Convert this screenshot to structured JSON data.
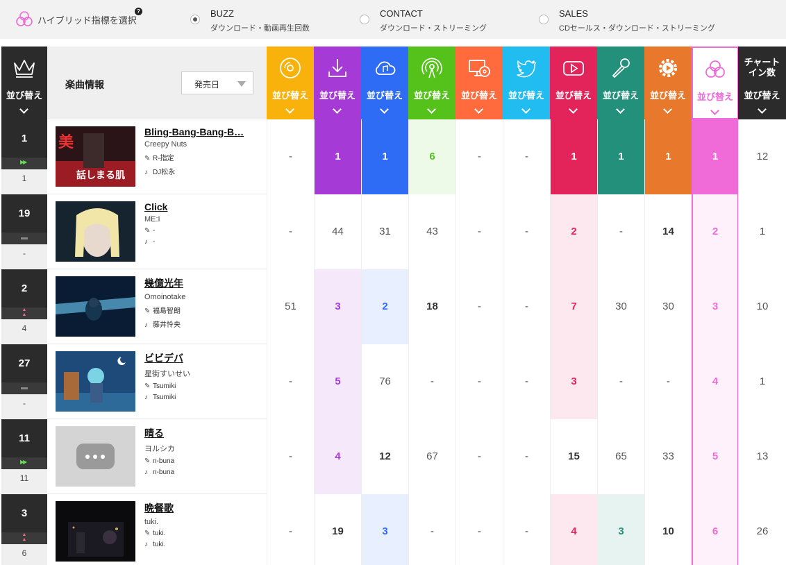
{
  "selector": {
    "title": "ハイブリッド指標を選択",
    "help": "?",
    "options": [
      {
        "name": "BUZZ",
        "sub": "ダウンロード・動画再生回数",
        "selected": true
      },
      {
        "name": "CONTACT",
        "sub": "ダウンロード・ストリーミング",
        "selected": false
      },
      {
        "name": "SALES",
        "sub": "CDセールス・ダウンロード・ストリーミング",
        "selected": false
      }
    ]
  },
  "header": {
    "sort_label": "並び替え",
    "info_title": "楽曲情報",
    "date_select": "発売日",
    "chart_in_title_1": "チャート",
    "chart_in_title_2": "イン数"
  },
  "columns": [
    {
      "icon": "cd-icon",
      "color": "#f9b20c"
    },
    {
      "icon": "download-icon",
      "color": "#a53ad6"
    },
    {
      "icon": "cloud-music-icon",
      "color": "#2f6cf5"
    },
    {
      "icon": "broadcast-icon",
      "color": "#55c21c"
    },
    {
      "icon": "pc-cd-icon",
      "color": "#ff6b3c"
    },
    {
      "icon": "twitter-icon",
      "color": "#21bdf0"
    },
    {
      "icon": "youtube-icon",
      "color": "#e3245a"
    },
    {
      "icon": "karaoke-mic-icon",
      "color": "#23907c"
    },
    {
      "icon": "gear-play-icon",
      "color": "#e8782c"
    },
    {
      "icon": "hybrid-icon",
      "color": "#f06ad8"
    }
  ],
  "rows": [
    {
      "rank": "1",
      "prev": "1",
      "move": "up",
      "title": "Bling-Bang-Bang-B…",
      "artist": "Creepy Nuts",
      "lyricist": "R-指定",
      "composer": "DJ松永",
      "values": [
        "-",
        "1",
        "1",
        "6",
        "-",
        "-",
        "1",
        "1",
        "1",
        "1"
      ],
      "chart_in": "12"
    },
    {
      "rank": "19",
      "prev": "-",
      "move": "same",
      "title": "Click",
      "artist": "ME:I",
      "lyricist": "-",
      "composer": "-",
      "values": [
        "-",
        "44",
        "31",
        "43",
        "-",
        "-",
        "2",
        "-",
        "14",
        "2"
      ],
      "chart_in": "1"
    },
    {
      "rank": "2",
      "prev": "4",
      "move": "rise",
      "title": "幾億光年",
      "artist": "Omoinotake",
      "lyricist": "福島智朗",
      "composer": "藤井怜央",
      "values": [
        "51",
        "3",
        "2",
        "18",
        "-",
        "-",
        "7",
        "30",
        "30",
        "3"
      ],
      "chart_in": "10"
    },
    {
      "rank": "27",
      "prev": "-",
      "move": "same",
      "title": "ビビデバ",
      "artist": "星街すいせい",
      "lyricist": "Tsumiki",
      "composer": "Tsumiki",
      "values": [
        "-",
        "5",
        "76",
        "-",
        "-",
        "-",
        "3",
        "-",
        "-",
        "4"
      ],
      "chart_in": "1"
    },
    {
      "rank": "11",
      "prev": "11",
      "move": "up",
      "title": "晴る",
      "artist": "ヨルシカ",
      "lyricist": "n-buna",
      "composer": "n-buna",
      "values": [
        "-",
        "4",
        "12",
        "67",
        "-",
        "-",
        "15",
        "65",
        "33",
        "5"
      ],
      "chart_in": "13"
    },
    {
      "rank": "3",
      "prev": "6",
      "move": "rise",
      "title": "晩餐歌",
      "artist": "tuki.",
      "lyricist": "tuki.",
      "composer": "tuki.",
      "values": [
        "-",
        "19",
        "3",
        "-",
        "-",
        "-",
        "4",
        "3",
        "10",
        "6"
      ],
      "chart_in": "26"
    }
  ]
}
